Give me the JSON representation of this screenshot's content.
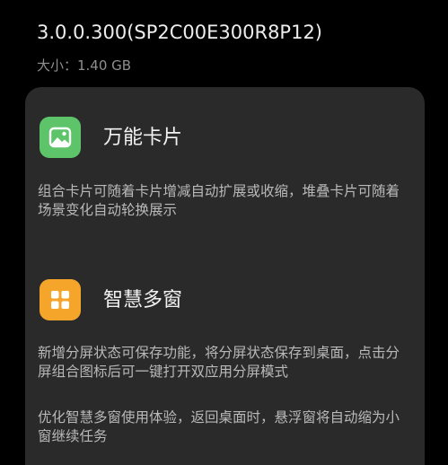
{
  "header": {
    "version": "3.0.0.300(SP2C00E300R8P12)",
    "size": "大小：1.40 GB"
  },
  "features": [
    {
      "icon": "image-card-icon",
      "icon_color": "#5dc46a",
      "title": "万能卡片",
      "descriptions": [
        "组合卡片可随着卡片增减自动扩展或收缩，堆叠卡片可随着场景变化自动轮换展示"
      ]
    },
    {
      "icon": "grid-windows-icon",
      "icon_color": "#f5a52a",
      "title": "智慧多窗",
      "descriptions": [
        "新增分屏状态可保存功能，将分屏状态保存到桌面，点击分屏组合图标后可一键打开双应用分屏模式",
        "优化智慧多窗使用体验，返回桌面时，悬浮窗将自动缩为小窗继续任务"
      ]
    }
  ]
}
